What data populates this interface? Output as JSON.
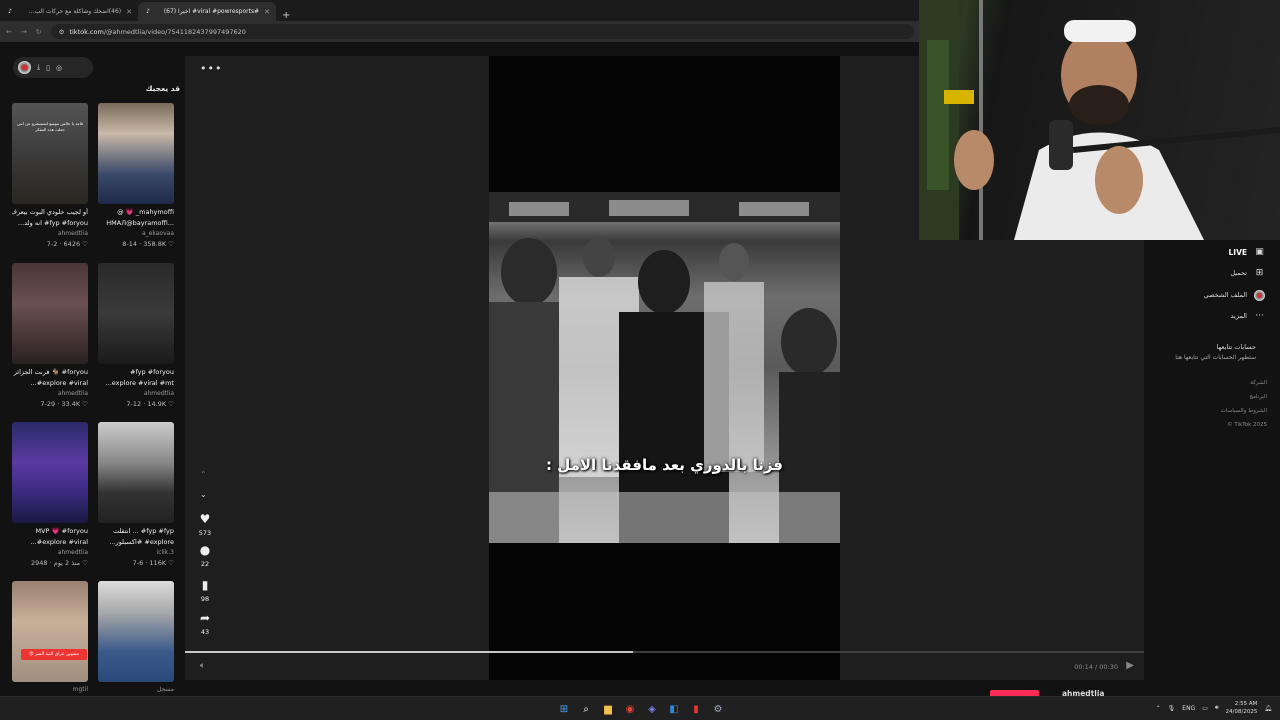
{
  "browser": {
    "tabs": [
      {
        "title": "(46)اضحك وشاكلة مع حركات الب...",
        "active": false,
        "favicon": "music-note-icon"
      },
      {
        "title": "#viral #powresports# اخيراً (67)",
        "active": true,
        "favicon": "tiktok-icon"
      }
    ],
    "url_domain": "tiktok.com",
    "url_path": "/@ahmedtlia/video/7541182437997497620"
  },
  "sidebar_left": {
    "section_title": "قد يعجبك",
    "videos": [
      {
        "line1": "أو لجيب خلودي البوت بيعرف",
        "line2": "fyp #foryou# انه ولد...",
        "author": "ahmedtlia",
        "date": "7-2",
        "likes": "6426",
        "overlay": "قاعد يا جالس نتوسع لتستبشرو عن انني جعلت هذه المفكر"
      },
      {
        "line1": "mahymoffi_ 💗 @",
        "line2": "...HMAЛ@bayramoffi",
        "author": "a_ekaovaa",
        "date": "8-14",
        "likes": "358.8K",
        "overlay": ""
      },
      {
        "line1": "foryou# 🐐 فرنت الجزائر",
        "line2": "explore #viral#...",
        "author": "ahmedtlia",
        "date": "7-29",
        "likes": "33.4K",
        "overlay": ""
      },
      {
        "line1": "fyp #foryou#",
        "line2": "explore #viral #mt...",
        "author": "ahmedtlia",
        "date": "7-12",
        "likes": "14.9K",
        "overlay": ""
      },
      {
        "line1": "MVP 💗 #foryou",
        "line2": "explore #viral#...",
        "author": "ahmedtlia",
        "date": "منذ 2 يوم",
        "likes": "2948",
        "overlay": ""
      },
      {
        "line1": "fyp #fyp# ... انتقلت",
        "line2": "explore# #اكسبلور...",
        "author": "iclik.3",
        "date": "7-6",
        "likes": "116K",
        "overlay": ""
      },
      {
        "line1": "",
        "line2": "",
        "author": "mgtil",
        "date": "",
        "likes": "",
        "overlay": "",
        "badge": "مشهور عراق الثبة السر 😡"
      },
      {
        "line1": "",
        "line2": "",
        "author": "مسجل",
        "date": "",
        "likes": "",
        "overlay": ""
      }
    ]
  },
  "player": {
    "caption": "فزنا بالدوري بعد مافقدنا الامل :",
    "likes": "573",
    "comments": "22",
    "saves": "98",
    "shares": "43",
    "time": "00:14 / 00:30",
    "progress_pct": 46.7
  },
  "sidebar_right": {
    "items": [
      {
        "label": "LIVE",
        "icon": "live-icon"
      },
      {
        "label": "تحميل",
        "icon": "upload-icon"
      },
      {
        "label": "الملف الشخصي",
        "icon": "profile-avatar-icon"
      },
      {
        "label": "المزيد",
        "icon": "more-dots-icon"
      }
    ],
    "following_heading": "حسابات تتابعها",
    "following_sub": "ستظهر الحسابات التي تتابعها هنا",
    "footer": [
      "الشركة",
      "البرنامج",
      "الشروط والسياسات",
      "TikTok 2025 ©"
    ],
    "bottom_user": "ahmedtlia"
  },
  "taskbar": {
    "lang": "ENG",
    "time": "2:55 AM",
    "date": "24/08/2025"
  }
}
